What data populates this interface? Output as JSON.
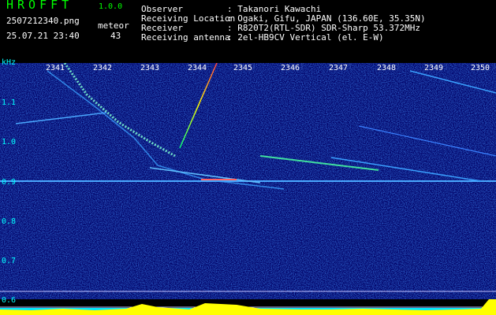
{
  "app": {
    "title": "HROFFT",
    "version": "1.0.0"
  },
  "capture": {
    "file_name": "2507212340.png",
    "datetime": "25.07.21 23:40"
  },
  "meteor": {
    "label": "meteor",
    "count": "43"
  },
  "info": [
    {
      "key": "Observer",
      "value": ": Takanori Kawachi"
    },
    {
      "key": "Receiving Location",
      "value": ": Ogaki, Gifu, JAPAN (136.60E, 35.35N)"
    },
    {
      "key": "Receiver",
      "value": ": R820T2(RTL-SDR) SDR-Sharp 53.372MHz"
    },
    {
      "key": "Receiving antenna",
      "value": ": 2el-HB9CV Vertical (el. E-W)"
    }
  ],
  "spectrogram": {
    "y_unit": "kHz",
    "y_ticks": [
      "1.1",
      "1.0",
      "0.9",
      "0.8",
      "0.7",
      "0.6"
    ],
    "x_ticks": [
      "2341",
      "2342",
      "2343",
      "2344",
      "2345",
      "2346",
      "2347",
      "2348",
      "2349",
      "2350"
    ],
    "colors": {
      "background": "#000066",
      "carrier": "#3aa0ff",
      "baseline": "#ffff00",
      "floor": "#00e5ff"
    }
  }
}
